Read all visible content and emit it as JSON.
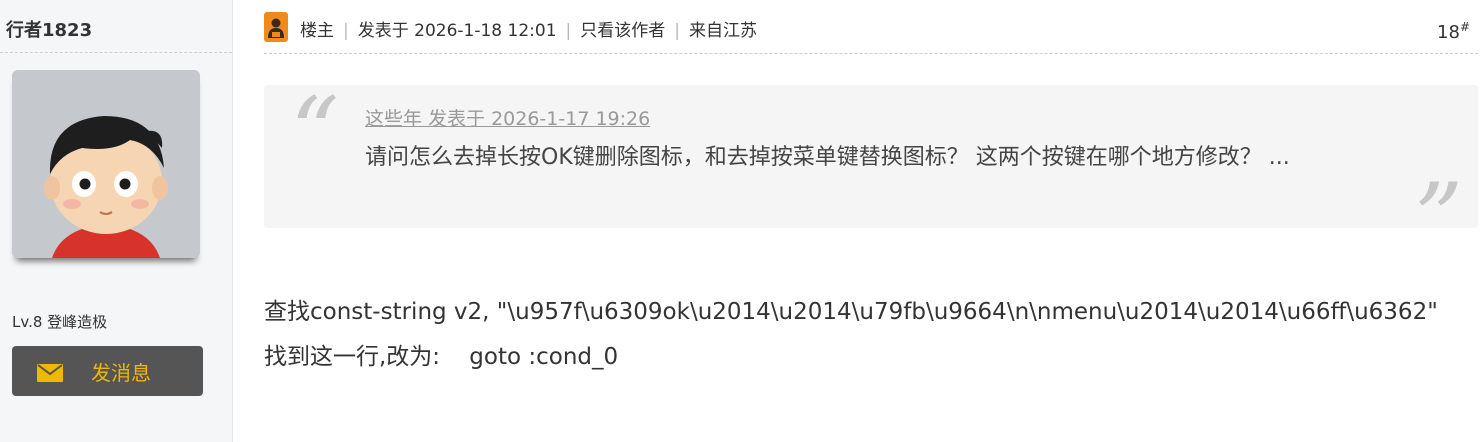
{
  "author": {
    "username": "行者1823",
    "level": "Lv.8 登峰造极",
    "message_button": "发消息"
  },
  "post_header": {
    "owner_label": "楼主",
    "posted": "发表于 2026-1-18 12:01",
    "only_author": "只看该作者",
    "location": "来自江苏",
    "floor_number": "18",
    "floor_mark": "#"
  },
  "quote": {
    "author_line": "这些年 发表于 2026-1-17 19:26",
    "text": "请问怎么去掉长按OK键删除图标，和去掉按菜单键替换图标？ 这两个按键在哪个地方修改？ ..."
  },
  "reply": {
    "line1": "查找const-string v2, \"\\u957f\\u6309ok\\u2014\\u2014\\u79fb\\u9664\\n\\nmenu\\u2014\\u2014\\u66ff\\u6362\"",
    "line2": "找到这一行,改为:    goto :cond_0"
  },
  "colors": {
    "button_bg": "#555555",
    "button_text": "#f0b800",
    "owner_icon": "#f08a1c",
    "quote_bg": "#f5f5f5",
    "side_bg": "#f5f6f8"
  },
  "icons": [
    "owner-icon",
    "envelope-icon",
    "open-quote-icon",
    "close-quote-icon",
    "avatar-cartoon-boy"
  ]
}
